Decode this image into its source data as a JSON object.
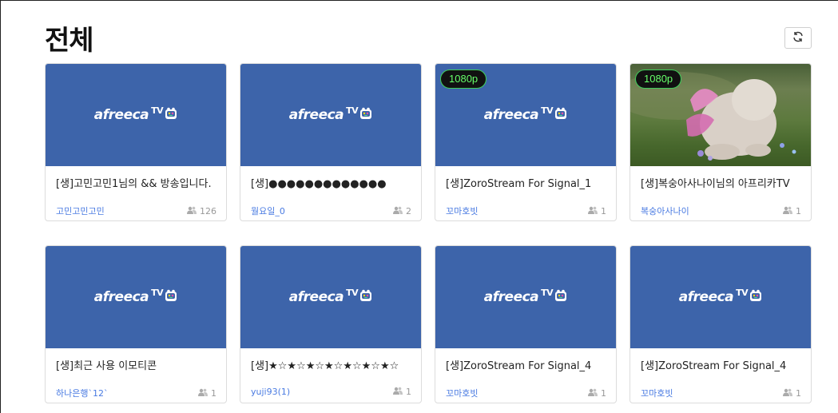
{
  "page": {
    "title": "전체"
  },
  "brand": {
    "logo_text": "afreeca",
    "logo_tv": "TV"
  },
  "colors": {
    "thumb_bg": "#3d64aa",
    "badge_text": "#67ff6a",
    "badge_border": "#3fcf5a",
    "streamer_link": "#4a7be2"
  },
  "streams": [
    {
      "title": "[생]고민고민1님의 && 방송입니다.",
      "streamer": "고민고민고민",
      "viewers": "126",
      "badge": "",
      "thumb": "logo"
    },
    {
      "title": "[생]●●●●●●●●●●●●●",
      "streamer": "월요일_0",
      "viewers": "2",
      "badge": "",
      "thumb": "logo"
    },
    {
      "title": "[생]ZoroStream For Signal_1",
      "streamer": "꼬마호빗",
      "viewers": "1",
      "badge": "1080p",
      "thumb": "logo"
    },
    {
      "title": "[생]복숭아사나이님의 아프리카TV",
      "streamer": "복숭아사나이",
      "viewers": "1",
      "badge": "1080p",
      "thumb": "scene"
    },
    {
      "title": "[생]최근 사용 이모티콘",
      "streamer": "하나은행`12`",
      "viewers": "1",
      "badge": "",
      "thumb": "logo"
    },
    {
      "title": "[생]★☆★☆★☆★☆★☆★☆★☆",
      "streamer": "yuji93(1)",
      "viewers": "1",
      "badge": "",
      "thumb": "logo"
    },
    {
      "title": "[생]ZoroStream For Signal_4",
      "streamer": "꼬마호빗",
      "viewers": "1",
      "badge": "",
      "thumb": "logo"
    },
    {
      "title": "[생]ZoroStream For Signal_4",
      "streamer": "꼬마호빗",
      "viewers": "1",
      "badge": "",
      "thumb": "logo"
    }
  ]
}
